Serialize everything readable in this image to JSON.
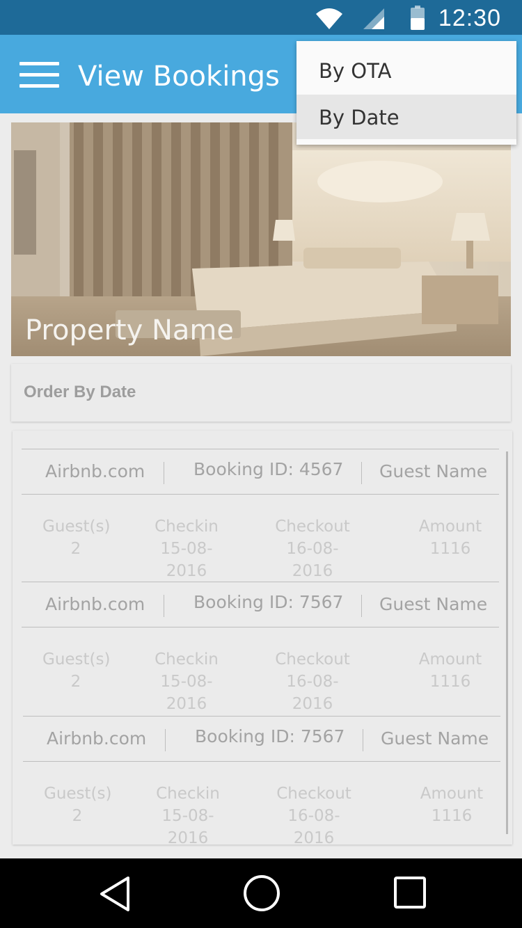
{
  "status_bar": {
    "time": "12:30"
  },
  "app_bar": {
    "title": "View Bookings"
  },
  "property": {
    "name": "Property Name"
  },
  "order_bar": {
    "label": "Order By Date"
  },
  "bookings": [
    {
      "source": "Airbnb.com",
      "booking_id": "Booking ID: 4567",
      "guest_name": "Guest Name",
      "guests_label": "Guest(s)",
      "guests": "2",
      "checkin_label": "Checkin",
      "checkin": "15-08-2016",
      "checkout_label": "Checkout",
      "checkout": "16-08-2016",
      "amount_label": "Amount",
      "amount": "1116"
    },
    {
      "source": "Airbnb.com",
      "booking_id": "Booking ID: 7567",
      "guest_name": "Guest Name",
      "guests_label": "Guest(s)",
      "guests": "2",
      "checkin_label": "Checkin",
      "checkin": "15-08-2016",
      "checkout_label": "Checkout",
      "checkout": "16-08-2016",
      "amount_label": "Amount",
      "amount": "1116"
    },
    {
      "source": "Airbnb.com",
      "booking_id": "Booking ID: 7567",
      "guest_name": "Guest Name",
      "guests_label": "Guest(s)",
      "guests": "2",
      "checkin_label": "Checkin",
      "checkin": "15-08-2016",
      "checkout_label": "Checkout",
      "checkout": "16-08-2016",
      "amount_label": "Amount",
      "amount": "1116"
    }
  ],
  "menu": {
    "items": [
      {
        "label": "By OTA"
      },
      {
        "label": "By Date"
      }
    ],
    "selected": "By Date"
  },
  "icons": {
    "status": [
      "wifi-icon",
      "signal-icon",
      "battery-icon"
    ],
    "nav": [
      "back-icon",
      "home-icon",
      "recents-icon"
    ],
    "app_bar": "menu-icon"
  },
  "colors": {
    "status_bar": "#1e6a98",
    "app_bar": "#48a9de",
    "background": "#ececec"
  }
}
